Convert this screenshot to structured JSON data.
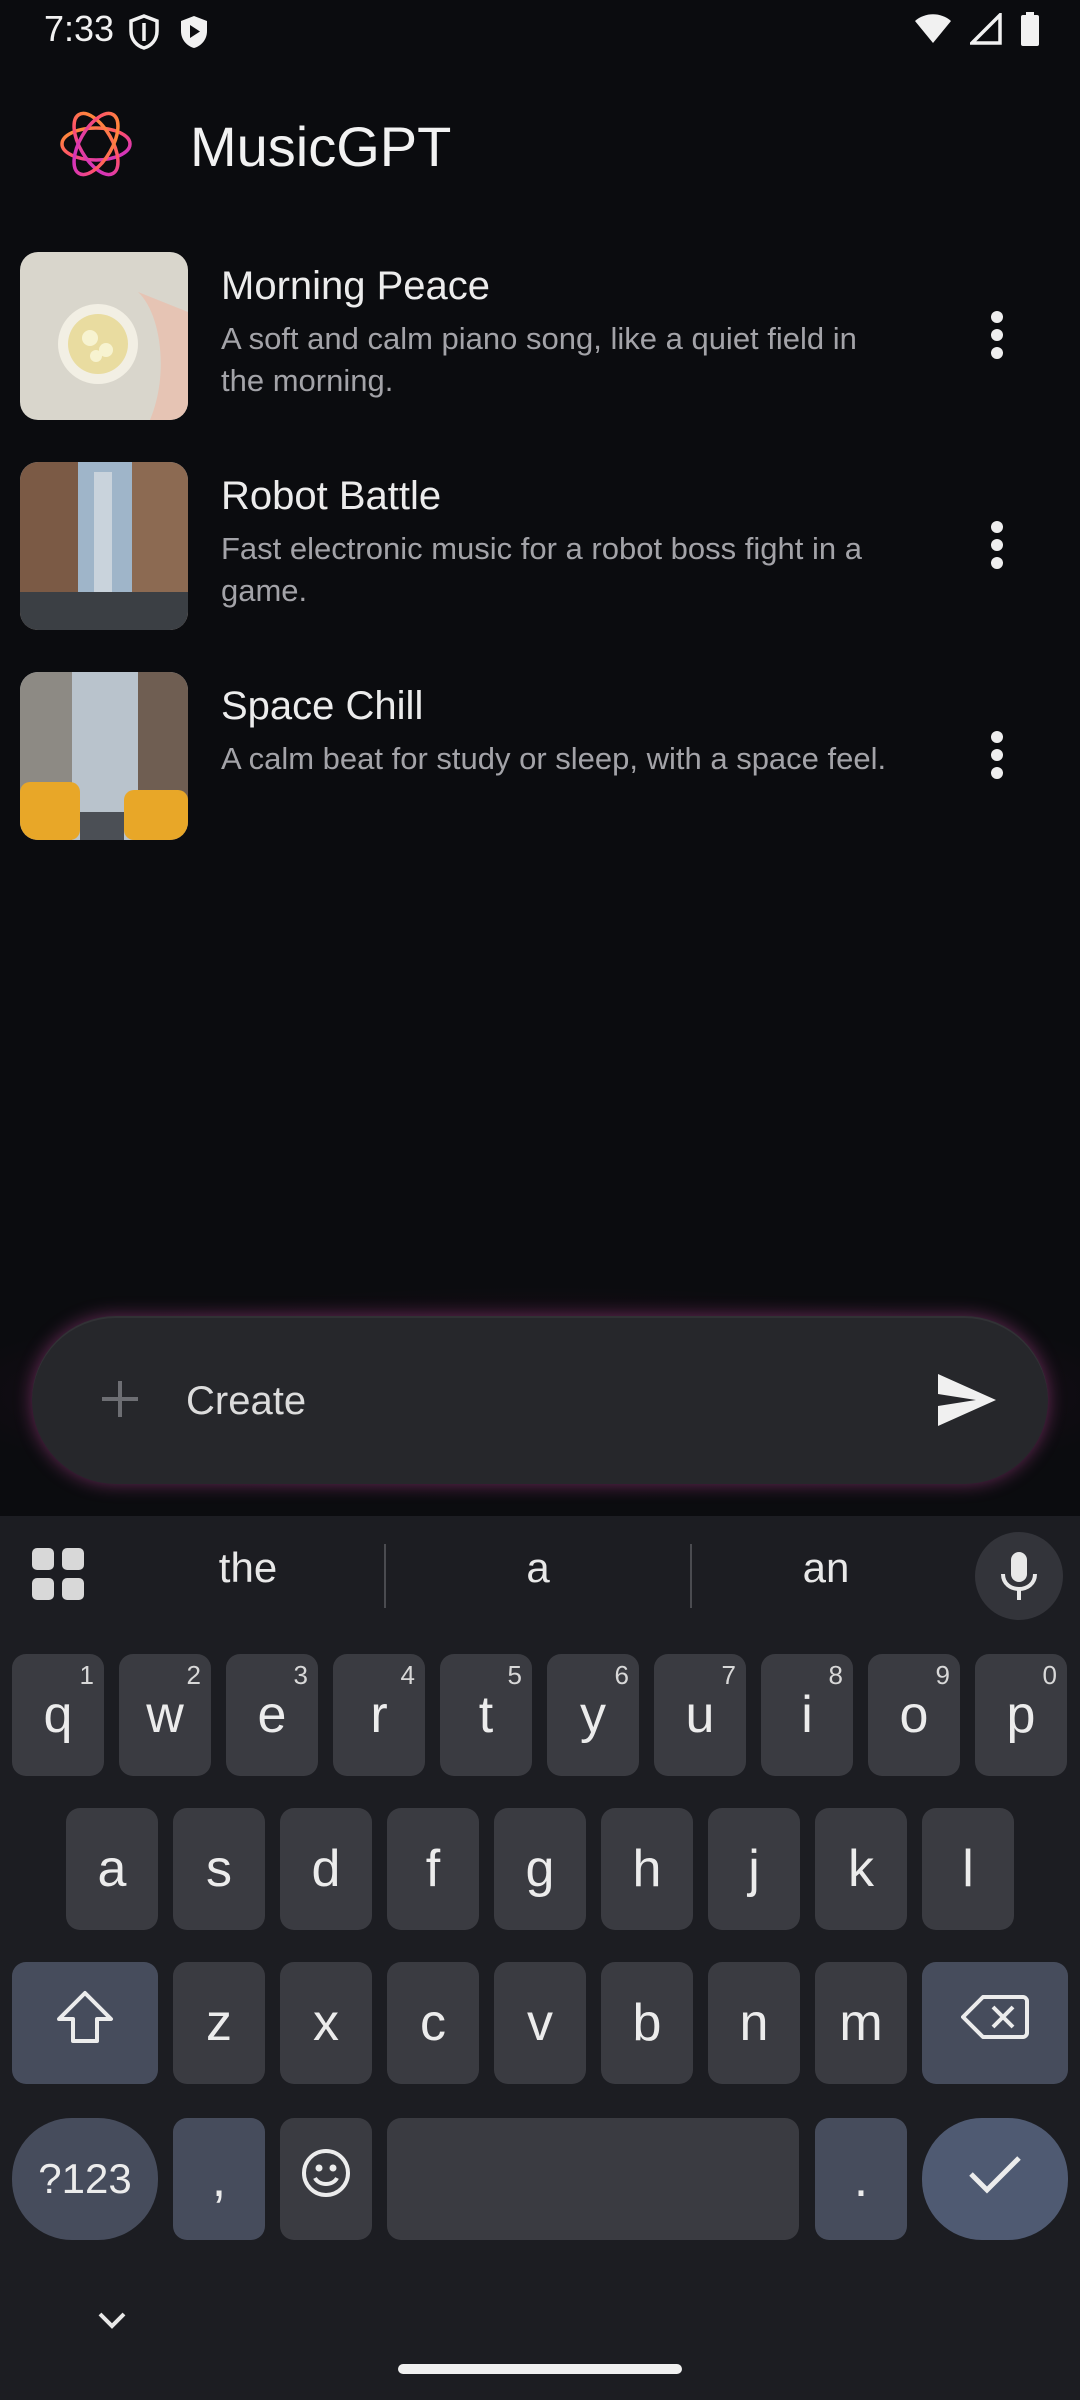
{
  "status_bar": {
    "time": "7:33",
    "icons": [
      "shield-icon",
      "play-shield-icon",
      "wifi-icon",
      "cell-signal-icon",
      "battery-icon"
    ]
  },
  "header": {
    "title": "MusicGPT",
    "logo_icon": "flower-logo-icon"
  },
  "songs": [
    {
      "title": "Morning Peace",
      "description": "A soft and calm piano song, like a quiet field in the morning.",
      "thumb": "tea-cup-image"
    },
    {
      "title": "Robot Battle",
      "description": "Fast electronic music for a robot boss fight in a game.",
      "thumb": "city-street-image"
    },
    {
      "title": "Space Chill",
      "description": "A calm beat for study or sleep, with a space feel.",
      "thumb": "taxi-street-image"
    }
  ],
  "composer": {
    "placeholder": "Create",
    "value": ""
  },
  "keyboard": {
    "suggestions": [
      "the",
      "a",
      "an"
    ],
    "row1": [
      {
        "k": "q",
        "h": "1"
      },
      {
        "k": "w",
        "h": "2"
      },
      {
        "k": "e",
        "h": "3"
      },
      {
        "k": "r",
        "h": "4"
      },
      {
        "k": "t",
        "h": "5"
      },
      {
        "k": "y",
        "h": "6"
      },
      {
        "k": "u",
        "h": "7"
      },
      {
        "k": "i",
        "h": "8"
      },
      {
        "k": "o",
        "h": "9"
      },
      {
        "k": "p",
        "h": "0"
      }
    ],
    "row2": [
      "a",
      "s",
      "d",
      "f",
      "g",
      "h",
      "j",
      "k",
      "l"
    ],
    "row3": [
      "z",
      "x",
      "c",
      "v",
      "b",
      "n",
      "m"
    ],
    "symbols_label": "?123",
    "comma": ",",
    "period": "."
  },
  "colors": {
    "background": "#0b0c0f",
    "composer": "#26272b",
    "glow": "#c83c9a",
    "keyboard": "#1c1d22"
  }
}
